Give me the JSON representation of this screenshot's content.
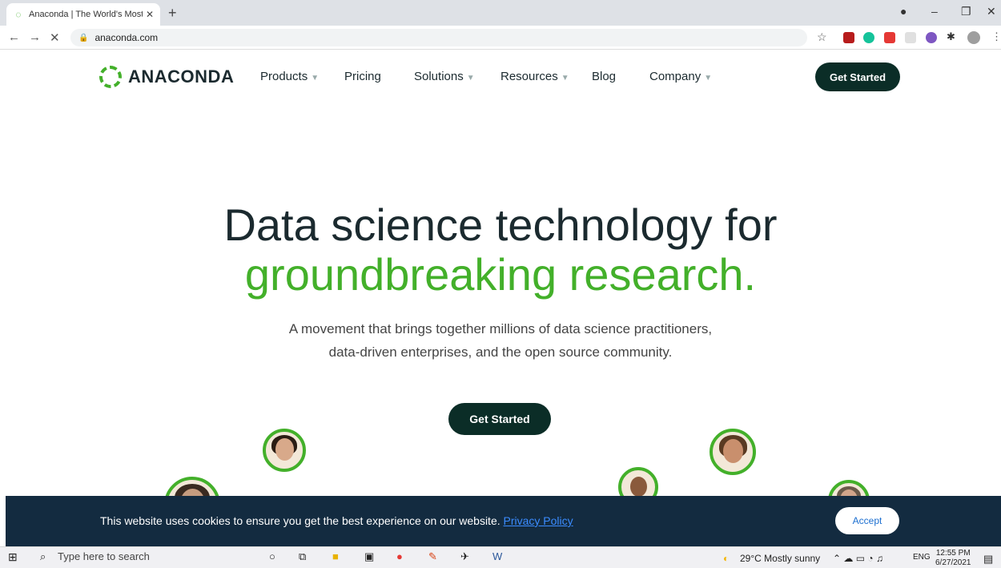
{
  "browser": {
    "tab_title": "Anaconda | The World's Most Po",
    "url": "anaconda.com"
  },
  "nav": {
    "logo": "ANACONDA",
    "links": [
      {
        "label": "Products",
        "dropdown": true
      },
      {
        "label": "Pricing",
        "dropdown": false
      },
      {
        "label": "Solutions",
        "dropdown": true
      },
      {
        "label": "Resources",
        "dropdown": true
      },
      {
        "label": "Blog",
        "dropdown": false
      },
      {
        "label": "Company",
        "dropdown": true
      }
    ],
    "cta": "Get Started"
  },
  "hero": {
    "line1": "Data science technology for",
    "line2": "groundbreaking research.",
    "subtitle_1": "A movement that brings together millions of data science practitioners,",
    "subtitle_2": "data-driven enterprises, and the open source community.",
    "cta": "Get Started"
  },
  "cookie": {
    "message": "This website uses cookies to ensure you get the best experience on our website.",
    "link": "Privacy Policy",
    "accept": "Accept"
  },
  "taskbar": {
    "search_placeholder": "Type here to search",
    "weather": "29°C  Mostly sunny",
    "lang": "ENG",
    "time": "12:55 PM",
    "date": "6/27/2021"
  },
  "colors": {
    "brand_green": "#43b02a",
    "dark": "#0b2d27",
    "cookie_bg": "#132b40"
  }
}
